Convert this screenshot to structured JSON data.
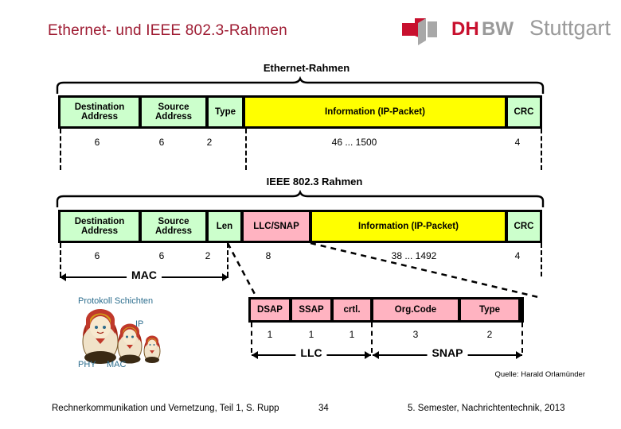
{
  "header": {
    "title": "Ethernet- und IEEE 802.3-Rahmen",
    "logo": {
      "dh": "DH",
      "bw": "BW",
      "city": "Stuttgart",
      "mark_red": "#c8102e",
      "mark_gray": "#9a9a9a"
    },
    "title_color": "#9e1b32"
  },
  "ethernet": {
    "heading": "Ethernet-Rahmen",
    "fields": [
      {
        "label": "Destination Address",
        "line1": "Destination",
        "line2": "Address",
        "color": "green",
        "size": "6"
      },
      {
        "label": "Source Address",
        "line1": "Source",
        "line2": "Address",
        "color": "green",
        "size": "6"
      },
      {
        "label": "Type",
        "line1": "Type",
        "line2": "",
        "color": "green",
        "size": "2"
      },
      {
        "label": "Information (IP-Packet)",
        "line1": "Information (IP-Packet)",
        "line2": "",
        "color": "yellow",
        "size": "46 ... 1500"
      },
      {
        "label": "CRC",
        "line1": "CRC",
        "line2": "",
        "color": "green",
        "size": "4"
      }
    ]
  },
  "ieee": {
    "heading": "IEEE 802.3 Rahmen",
    "fields": [
      {
        "label": "Destination Address",
        "line1": "Destination",
        "line2": "Address",
        "color": "green",
        "size": "6"
      },
      {
        "label": "Source Address",
        "line1": "Source",
        "line2": "Address",
        "color": "green",
        "size": "6"
      },
      {
        "label": "Len",
        "line1": "Len",
        "line2": "",
        "color": "green",
        "size": "2"
      },
      {
        "label": "LLC/SNAP",
        "line1": "LLC/SNAP",
        "line2": "",
        "color": "pink",
        "size": "8"
      },
      {
        "label": "Information (IP-Packet)",
        "line1": "Information (IP-Packet)",
        "line2": "",
        "color": "yellow",
        "size": "38 ... 1492"
      },
      {
        "label": "CRC",
        "line1": "CRC",
        "line2": "",
        "color": "green",
        "size": "4"
      }
    ],
    "mac_bracket": "MAC"
  },
  "llcsnap": {
    "fields": [
      {
        "label": "DSAP",
        "color": "pink",
        "size": "1"
      },
      {
        "label": "SSAP",
        "color": "pink",
        "size": "1"
      },
      {
        "label": "crtl.",
        "color": "pink",
        "size": "1"
      },
      {
        "label": "Org.Code",
        "color": "pink",
        "size": "3"
      },
      {
        "label": "Type",
        "color": "pink",
        "size": "2"
      }
    ],
    "llc_bracket": "LLC",
    "snap_bracket": "SNAP"
  },
  "layers": {
    "caption": "Protokoll Schichten",
    "ip": "IP",
    "phy": "PHY",
    "mac": "MAC",
    "label_color": "#2d6e8e"
  },
  "footer": {
    "source": "Quelle: Harald Orlamünder",
    "left": "Rechnerkommunikation und Vernetzung, Teil 1, S. Rupp",
    "page": "34",
    "right": "5. Semester, Nachrichtentechnik, 2013"
  }
}
